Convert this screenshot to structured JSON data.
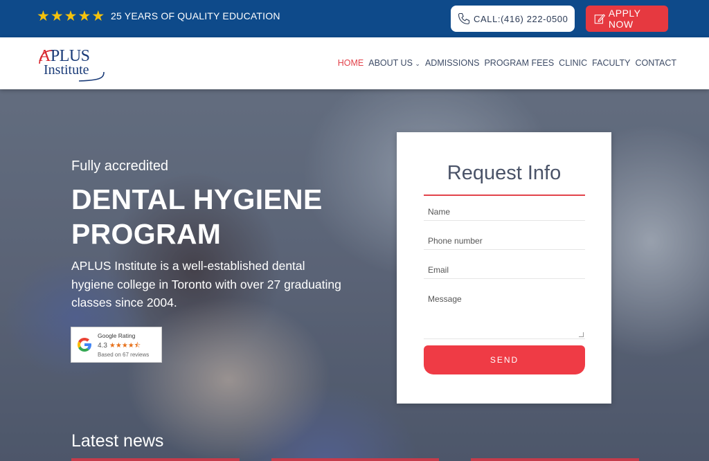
{
  "topbar": {
    "rating_stars": 5,
    "tagline": "25 YEARS OF QUALITY EDUCATION",
    "call_label": "CALL:(416) 222-0500",
    "apply_label": "APPLY NOW"
  },
  "logo": {
    "line1_first": "A",
    "line1_rest": "PLUS",
    "line2": "Institute"
  },
  "nav": {
    "items": [
      "HOME",
      "ABOUT US",
      "ADMISSIONS",
      "PROGRAM FEES",
      "CLINIC",
      "FACULTY",
      "CONTACT"
    ],
    "active": "HOME"
  },
  "hero": {
    "eyebrow": "Fully accredited",
    "title_line1": "DENTAL HYGIENE",
    "title_line2": "PROGRAM",
    "description": "APLUS Institute is a well-established dental hygiene college in Toronto with over 27 graduating classes since 2004.",
    "latest_heading": "Latest news"
  },
  "google_rating": {
    "label": "Google Rating",
    "score": "4.3",
    "stars": "★★★★⯪",
    "reviews": "Based on 67 reviews"
  },
  "form": {
    "title": "Request Info",
    "name_placeholder": "Name",
    "phone_placeholder": "Phone number",
    "email_placeholder": "Email",
    "message_placeholder": "Message",
    "send_label": "SEND"
  },
  "colors": {
    "topbar_bg": "#0e4a8a",
    "accent_red": "#ef3b45",
    "star_gold": "#f4c20d",
    "nav_text": "#3d4b66"
  }
}
